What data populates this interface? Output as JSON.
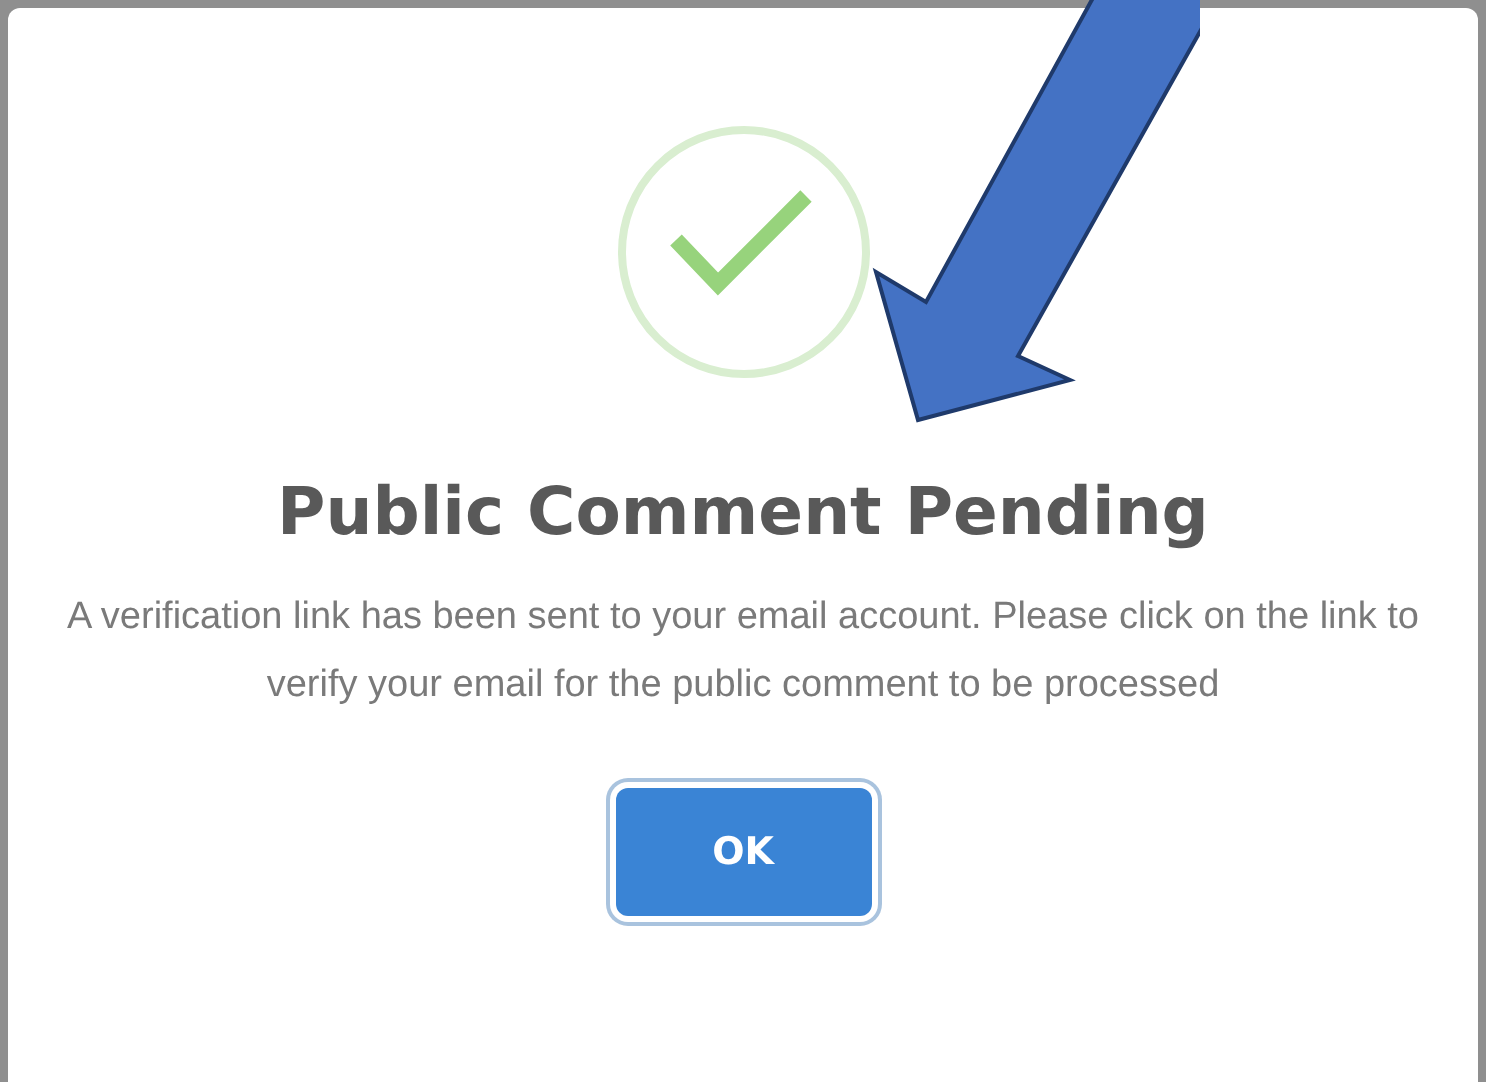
{
  "dialog": {
    "title": "Public Comment Pending",
    "message": "A verification link has been sent to your email account. Please click on the link to verify your email for the public comment to be processed",
    "buttons": [
      {
        "label": "OK",
        "focused": true
      }
    ]
  }
}
